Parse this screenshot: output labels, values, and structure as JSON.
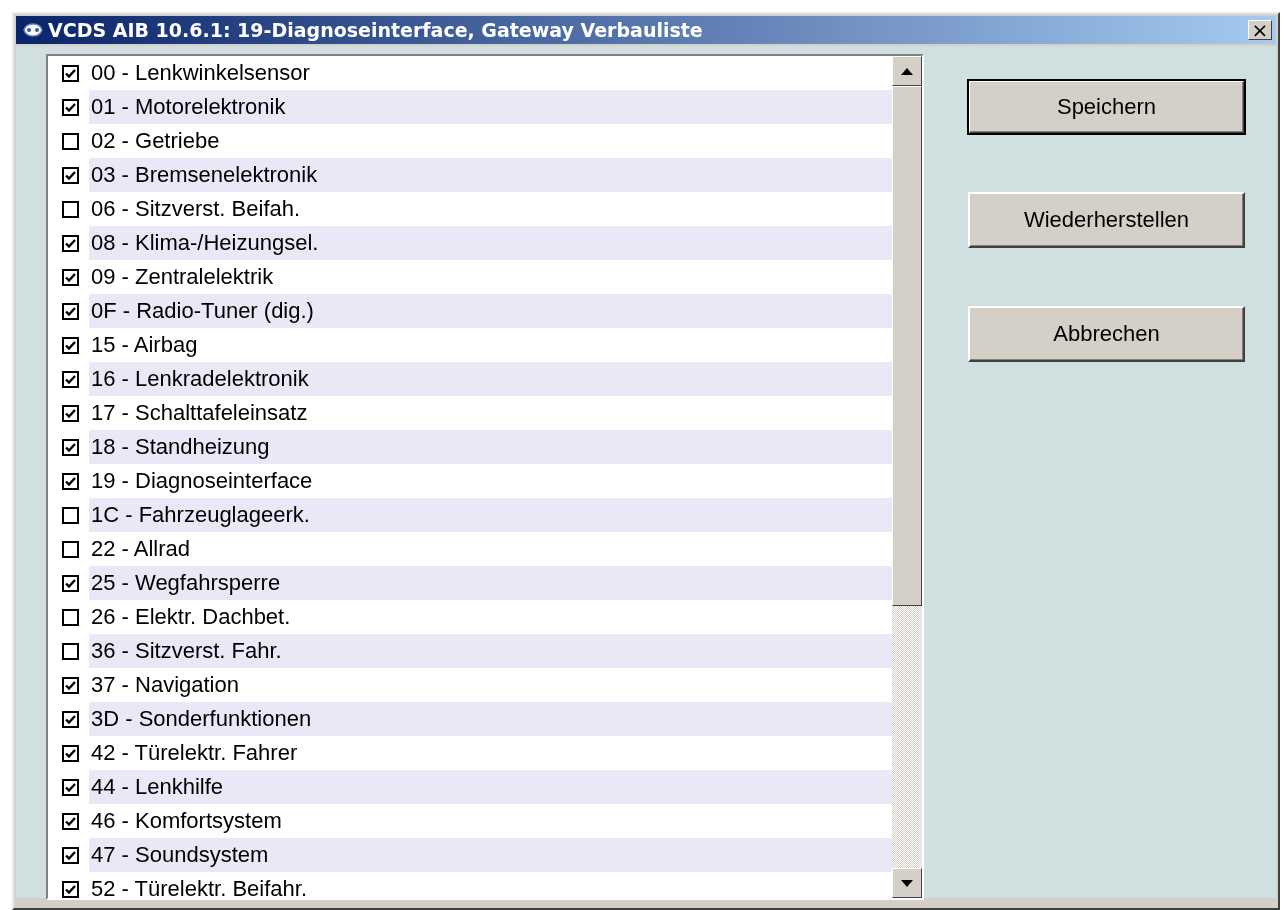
{
  "window": {
    "title": "VCDS AIB 10.6.1: 19-Diagnoseinterface,  Gateway Verbauliste",
    "close": "×"
  },
  "items": [
    {
      "label": "00 - Lenkwinkelsensor",
      "checked": true
    },
    {
      "label": "01 - Motorelektronik",
      "checked": true
    },
    {
      "label": "02 - Getriebe",
      "checked": false
    },
    {
      "label": "03 - Bremsenelektronik",
      "checked": true
    },
    {
      "label": "06 - Sitzverst. Beifah.",
      "checked": false
    },
    {
      "label": "08 - Klima-/Heizungsel.",
      "checked": true
    },
    {
      "label": "09 - Zentralelektrik",
      "checked": true
    },
    {
      "label": "0F - Radio-Tuner (dig.)",
      "checked": true
    },
    {
      "label": "15 - Airbag",
      "checked": true
    },
    {
      "label": "16 - Lenkradelektronik",
      "checked": true
    },
    {
      "label": "17 - Schalttafeleinsatz",
      "checked": true
    },
    {
      "label": "18 - Standheizung",
      "checked": true
    },
    {
      "label": "19 - Diagnoseinterface",
      "checked": true
    },
    {
      "label": "1C - Fahrzeuglageerk.",
      "checked": false
    },
    {
      "label": "22 - Allrad",
      "checked": false
    },
    {
      "label": "25 - Wegfahrsperre",
      "checked": true
    },
    {
      "label": "26 - Elektr. Dachbet.",
      "checked": false
    },
    {
      "label": "36 - Sitzverst. Fahr.",
      "checked": false
    },
    {
      "label": "37 - Navigation",
      "checked": true
    },
    {
      "label": "3D - Sonderfunktionen",
      "checked": true
    },
    {
      "label": "42 - Türelektr. Fahrer",
      "checked": true
    },
    {
      "label": "44 - Lenkhilfe",
      "checked": true
    },
    {
      "label": "46 - Komfortsystem",
      "checked": true
    },
    {
      "label": "47 - Soundsystem",
      "checked": true
    },
    {
      "label": "52 - Türelektr. Beifahr.",
      "checked": true
    }
  ],
  "buttons": [
    {
      "label": "Speichern",
      "default": true
    },
    {
      "label": "Wiederherstellen",
      "default": false
    },
    {
      "label": "Abbrechen",
      "default": false
    }
  ]
}
